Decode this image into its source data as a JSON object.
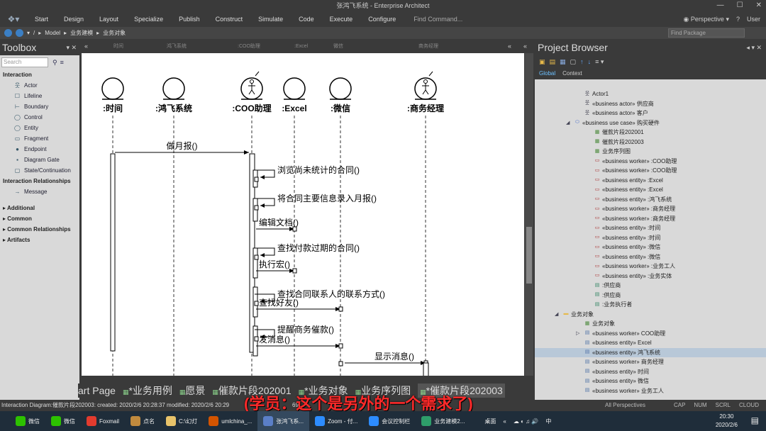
{
  "window": {
    "title": "张鸿飞系统 - Enterprise Architect"
  },
  "menu": {
    "items": [
      "Start",
      "Design",
      "Layout",
      "Specialize",
      "Publish",
      "Construct",
      "Simulate",
      "Code",
      "Execute",
      "Configure"
    ],
    "find": "Find Command...",
    "perspective": "Perspective",
    "user": "User"
  },
  "nav": {
    "path": [
      "/",
      "Model",
      "业务建模",
      "业务对象"
    ],
    "find_package": "Find Package"
  },
  "toolbox": {
    "title": "Toolbox",
    "search_placeholder": "Search",
    "sections": [
      {
        "name": "Interaction",
        "items": [
          "Actor",
          "Lifeline",
          "Boundary",
          "Control",
          "Entity",
          "Fragment",
          "Endpoint",
          "Diagram Gate",
          "State/Continuation"
        ]
      },
      {
        "name": "Interaction Relationships",
        "items": [
          "Message"
        ]
      },
      {
        "name": "Additional",
        "items": []
      },
      {
        "name": "Common",
        "items": []
      },
      {
        "name": "Common Relationships",
        "items": []
      },
      {
        "name": "Artifacts",
        "items": []
      }
    ]
  },
  "diagram": {
    "header_labels": [
      "时间",
      "鸿飞系统",
      ":COO助理",
      ":Excel",
      "微信",
      "商务经理"
    ],
    "lifelines": [
      {
        "label": ":时间",
        "kind": "entity"
      },
      {
        "label": ":鸿飞系统",
        "kind": "entity"
      },
      {
        "label": ":COO助理",
        "kind": "worker"
      },
      {
        "label": ":Excel",
        "kind": "entity"
      },
      {
        "label": ":微信",
        "kind": "entity"
      },
      {
        "label": ":商务经理",
        "kind": "worker"
      }
    ],
    "messages": [
      {
        "label": "做月报()",
        "from": 0,
        "to": 2
      },
      {
        "label": "浏览尚未统计的合同()",
        "from": 2,
        "to": 2
      },
      {
        "label": "将合同主要信息录入月报()",
        "from": 2,
        "to": 2
      },
      {
        "label": "编辑文档()",
        "from": 2,
        "to": 3
      },
      {
        "label": "查找付款过期的合同()",
        "from": 2,
        "to": 2
      },
      {
        "label": "执行宏()",
        "from": 2,
        "to": 3
      },
      {
        "label": "查找合同联系人的联系方式()",
        "from": 2,
        "to": 2
      },
      {
        "label": "查找好友()",
        "from": 2,
        "to": 4
      },
      {
        "label": "提醒商务催款()",
        "from": 2,
        "to": 2
      },
      {
        "label": "发消息()",
        "from": 2,
        "to": 4
      },
      {
        "label": "显示消息()",
        "from": 4,
        "to": 5
      }
    ]
  },
  "doc_tabs": [
    "art Page",
    "*业务用例",
    "愿景",
    "催款片段202001",
    "*业务对象",
    "业务序列图",
    "*催款片段202003"
  ],
  "project_browser": {
    "title": "Project Browser",
    "tabs": [
      "Global",
      "Context"
    ],
    "rows": [
      {
        "text": "Actor1",
        "indent": 70,
        "icon": "actor"
      },
      {
        "text": "«business actor» 供应商",
        "indent": 70,
        "icon": "actor"
      },
      {
        "text": "«business actor» 客户",
        "indent": 70,
        "icon": "actor"
      },
      {
        "text": "«business use case» 购买硬件",
        "indent": 56,
        "icon": "usecase",
        "expander": "◢"
      },
      {
        "text": "催款片段202001",
        "indent": 84,
        "icon": "diagram"
      },
      {
        "text": "催款片段202003",
        "indent": 84,
        "icon": "diagram"
      },
      {
        "text": "业务序列图",
        "indent": 84,
        "icon": "diagram"
      },
      {
        "text": "«business worker» :COO助理",
        "indent": 84,
        "icon": "box"
      },
      {
        "text": "«business worker» :COO助理",
        "indent": 84,
        "icon": "box"
      },
      {
        "text": "«business entity» :Excel",
        "indent": 84,
        "icon": "box"
      },
      {
        "text": "«business entity» :Excel",
        "indent": 84,
        "icon": "box"
      },
      {
        "text": "«business entity» :鸿飞系统",
        "indent": 84,
        "icon": "box"
      },
      {
        "text": "«business worker» :商务经理",
        "indent": 84,
        "icon": "box"
      },
      {
        "text": "«business worker» :商务经理",
        "indent": 84,
        "icon": "box"
      },
      {
        "text": "«business entity» :时间",
        "indent": 84,
        "icon": "box"
      },
      {
        "text": "«business entity» :时间",
        "indent": 84,
        "icon": "box"
      },
      {
        "text": "«business entity» :微信",
        "indent": 84,
        "icon": "box"
      },
      {
        "text": "«business entity» :微信",
        "indent": 84,
        "icon": "box"
      },
      {
        "text": "«business worker» :业务工人",
        "indent": 84,
        "icon": "box"
      },
      {
        "text": "«business entity» :业务实体",
        "indent": 84,
        "icon": "box"
      },
      {
        "text": ":供应商",
        "indent": 84,
        "icon": "note"
      },
      {
        "text": ":供应商",
        "indent": 84,
        "icon": "note"
      },
      {
        "text": ":业务执行者",
        "indent": 84,
        "icon": "note"
      },
      {
        "text": "业务对象",
        "indent": 40,
        "icon": "folder",
        "expander": "◢"
      },
      {
        "text": "业务对象",
        "indent": 70,
        "icon": "diagram"
      },
      {
        "text": "«business worker» COO助理",
        "indent": 70,
        "icon": "doc",
        "expander": "▷"
      },
      {
        "text": "«business entity» Excel",
        "indent": 70,
        "icon": "doc"
      },
      {
        "text": "«business entity» 鸿飞系统",
        "indent": 70,
        "icon": "doc",
        "selected": true
      },
      {
        "text": "«business worker» 商务经理",
        "indent": 70,
        "icon": "doc"
      },
      {
        "text": "«business entity» 时间",
        "indent": 70,
        "icon": "doc"
      },
      {
        "text": "«business entity» 微信",
        "indent": 70,
        "icon": "doc"
      },
      {
        "text": "«business worker» 业务工人",
        "indent": 70,
        "icon": "doc"
      }
    ]
  },
  "status": {
    "left": "Interaction Diagram:催款片段202003:   created: 2020/2/6 20:28:37  modified: 2020/2/6 20:29",
    "num": "69",
    "perspectives": "All Perspectives",
    "flags": [
      "CAP",
      "NUM",
      "SCRL",
      "CLOUD"
    ]
  },
  "subtitle": "(学员：这个是另外的一个需求了)",
  "taskbar": {
    "items": [
      {
        "label": "微信",
        "color": "#2dc100"
      },
      {
        "label": "微信",
        "color": "#2dc100"
      },
      {
        "label": "Foxmail",
        "color": "#e23b2e"
      },
      {
        "label": "点名",
        "color": "#c08a3e"
      },
      {
        "label": "C:\\幻灯",
        "color": "#e8c36a"
      },
      {
        "label": "umlchina_...",
        "color": "#d35400"
      },
      {
        "label": "张鸿飞系...",
        "color": "#5b7fc7",
        "active": true
      },
      {
        "label": "Zoom - 付...",
        "color": "#2d8cff"
      },
      {
        "label": "会议控制栏",
        "color": "#2d8cff"
      },
      {
        "label": "业务建模2...",
        "color": "#2e9e6a"
      }
    ],
    "tray": "桌面",
    "ime": "中",
    "time": "20:30",
    "date": "2020/2/6"
  }
}
